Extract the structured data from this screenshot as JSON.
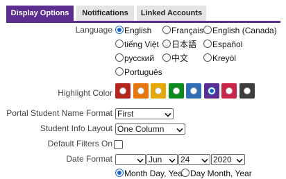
{
  "tabs": [
    {
      "label": "Display Options",
      "active": true
    },
    {
      "label": "Notifications",
      "active": false
    },
    {
      "label": "Linked Accounts",
      "active": false
    }
  ],
  "language": {
    "label": "Language",
    "options": [
      "English",
      "Français",
      "English (Canada)",
      "tiếng Việt",
      "日本語",
      "Español",
      "русский",
      "中文",
      "Kreyòl",
      "Português"
    ],
    "selected": "English"
  },
  "highlight_color": {
    "label": "Highlight Color",
    "colors": [
      "#b3261e",
      "#e8760f",
      "#e6a800",
      "#0a8a1f",
      "#2f6db5",
      "#5b2d8e",
      "#c9254a",
      "#3d3d3d"
    ],
    "selected_index": 5
  },
  "portal_name_format": {
    "label": "Portal Student Name Format",
    "value": "First"
  },
  "student_info_layout": {
    "label": "Student Info Layout",
    "value": "One Column"
  },
  "default_filters": {
    "label": "Default Filters On",
    "checked": false
  },
  "date_format": {
    "label": "Date Format",
    "first": "",
    "month": "Jun",
    "day": "24",
    "year": "2020",
    "order_options": [
      "Month Day, Year",
      "Day Month, Year"
    ],
    "order_selected": "Month Day, Year"
  }
}
